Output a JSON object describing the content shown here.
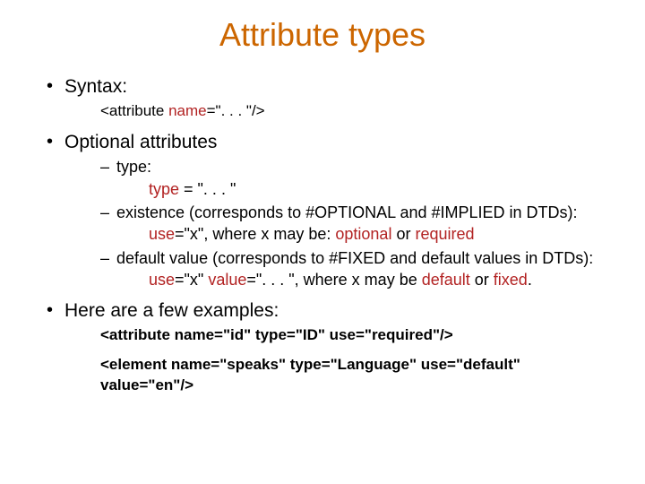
{
  "title": "Attribute types",
  "bullets": {
    "syntax": {
      "label": "Syntax:",
      "code_open": "<attribute ",
      "code_attr": "name",
      "code_rest": "=\". . . \"/>"
    },
    "optional": {
      "label": "Optional attributes",
      "type": {
        "label": "type:",
        "expr_pre": "type",
        "expr_post": " = \". . . \""
      },
      "existence": {
        "label": "existence (corresponds to #OPTIONAL and #IMPLIED in DTDs):",
        "expr_pre": "use",
        "expr_mid": "=\"x\", where x may be: ",
        "v1": "optional",
        "or": " or ",
        "v2": "required"
      },
      "default": {
        "label": "default value (corresponds to #FIXED and default values in DTDs):",
        "expr_pre": "use",
        "expr_mid1": "=\"x\" ",
        "expr_val": "value",
        "expr_mid2": "=\". . . \", where x may be ",
        "v1": "default",
        "or": " or ",
        "v2": "fixed",
        "period": "."
      }
    },
    "examples": {
      "label": "Here are a few examples:",
      "line1": "<attribute name=\"id\" type=\"ID\" use=\"required\"/>",
      "line2": "<element name=\"speaks\" type=\"Language\" use=\"default\" value=\"en\"/>"
    }
  }
}
